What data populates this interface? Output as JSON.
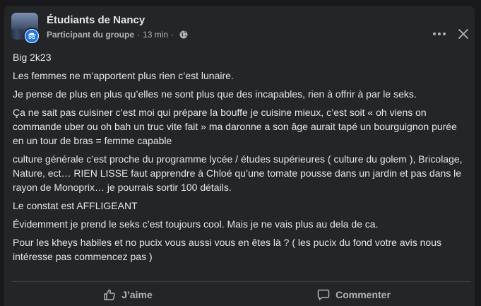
{
  "post": {
    "group_name": "Étudiants de Nancy",
    "role": "Participant du groupe",
    "separator": "·",
    "time": "13 min",
    "separator2": "·",
    "paragraphs": [
      "Big 2k23",
      "Les femmes ne m’apportent plus rien c’est lunaire.",
      "Je pense de plus en plus qu’elles ne sont plus que des incapables, rien à offrir à par le seks.",
      "Ça ne sait pas cuisiner c’est moi qui prépare la bouffe je cuisine mieux, c’est soit « oh viens on commande uber ou oh bah un truc vite fait » ma daronne a son âge aurait tapé un bourguignon purée en un tour de bras = femme capable",
      " culture générale c’est proche du programme lycée / études supérieures ( culture du golem ), Bricolage, Nature, ect… RIEN LISSE faut apprendre à Chloé qu’une tomate pousse dans un jardin et pas dans le rayon de Monoprix… je pourrais sortir 100 détails.",
      "Le constat est AFFLIGEANT",
      "Évidemment je prend le seks c’est toujours cool. Mais je ne vais plus au dela de ca.",
      "Pour les kheys habiles et no pucix vous aussi vous en êtes là ? ( les pucix du fond votre avis nous intéresse pas commencez pas )"
    ]
  },
  "actions": {
    "like_label": "J’aime",
    "comment_label": "Commenter"
  },
  "icons": {
    "more": "more-horizontal-icon",
    "close": "close-icon",
    "globe": "globe-icon",
    "like": "thumbs-up-icon",
    "comment": "comment-icon",
    "user": "anonymous-user-icon"
  },
  "colors": {
    "background": "#18191a",
    "card": "#242526",
    "text_primary": "#e4e6eb",
    "text_secondary": "#b0b3b8",
    "accent": "#1877f2"
  }
}
